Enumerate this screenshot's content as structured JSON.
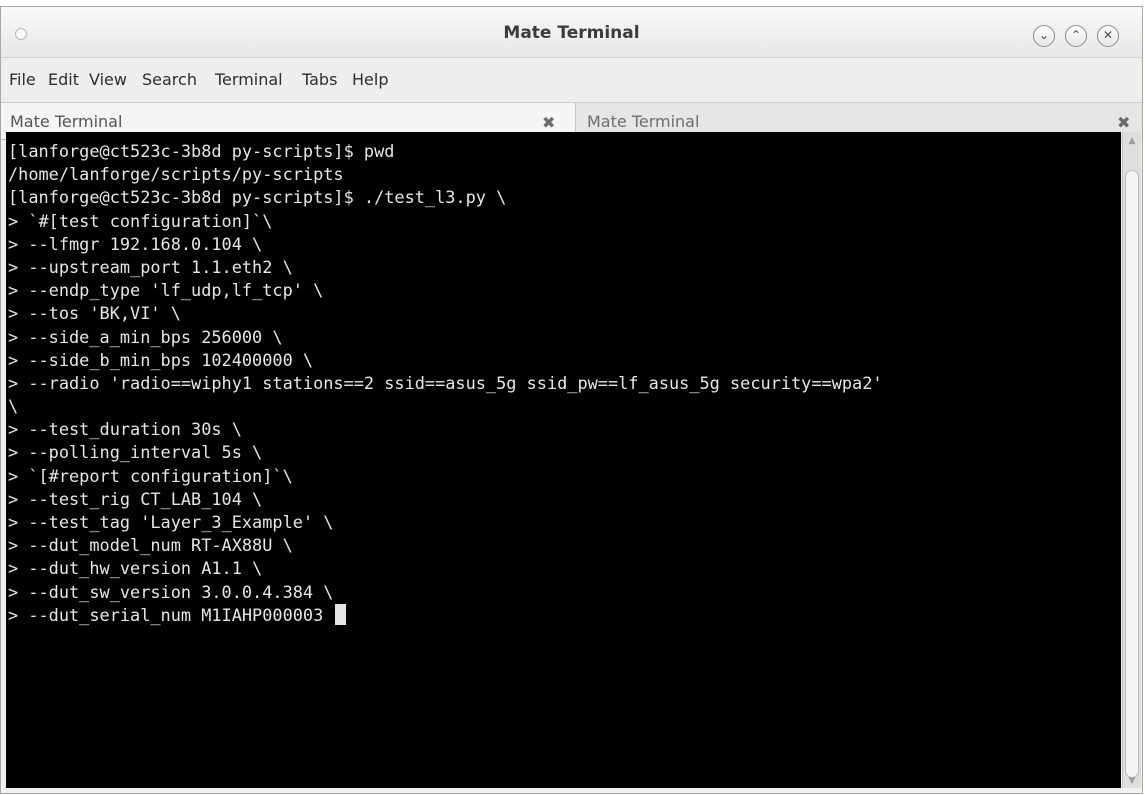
{
  "window": {
    "title": "Mate Terminal",
    "controls": {
      "minimize_icon": "⌄",
      "maximize_icon": "⌃",
      "close_icon": "✕"
    }
  },
  "menubar": {
    "items": [
      "File",
      "Edit",
      "View",
      "Search",
      "Terminal",
      "Tabs",
      "Help"
    ]
  },
  "tabs": [
    {
      "label": "Mate Terminal",
      "close_icon": "✖"
    },
    {
      "label": "Mate Terminal",
      "close_icon": "✖"
    }
  ],
  "terminal": {
    "lines": [
      "[lanforge@ct523c-3b8d py-scripts]$ pwd",
      "/home/lanforge/scripts/py-scripts",
      "[lanforge@ct523c-3b8d py-scripts]$ ./test_l3.py \\",
      "> `#[test configuration]`\\",
      "> --lfmgr 192.168.0.104 \\",
      "> --upstream_port 1.1.eth2 \\",
      "> --endp_type 'lf_udp,lf_tcp' \\",
      "> --tos 'BK,VI' \\",
      "> --side_a_min_bps 256000 \\",
      "> --side_b_min_bps 102400000 \\",
      "> --radio 'radio==wiphy1 stations==2 ssid==asus_5g ssid_pw==lf_asus_5g security==wpa2'",
      "\\",
      "> --test_duration 30s \\",
      "> --polling_interval 5s \\",
      "> `[#report configuration]`\\",
      "> --test_rig CT_LAB_104 \\",
      "> --test_tag 'Layer_3_Example' \\",
      "> --dut_model_num RT-AX88U \\",
      "> --dut_hw_version A1.1 \\",
      "> --dut_sw_version 3.0.0.4.384 \\"
    ],
    "current_input": "> --dut_serial_num M1IAHP000003 ",
    "colors": {
      "background": "#000000",
      "foreground": "#e6e6e6"
    }
  }
}
